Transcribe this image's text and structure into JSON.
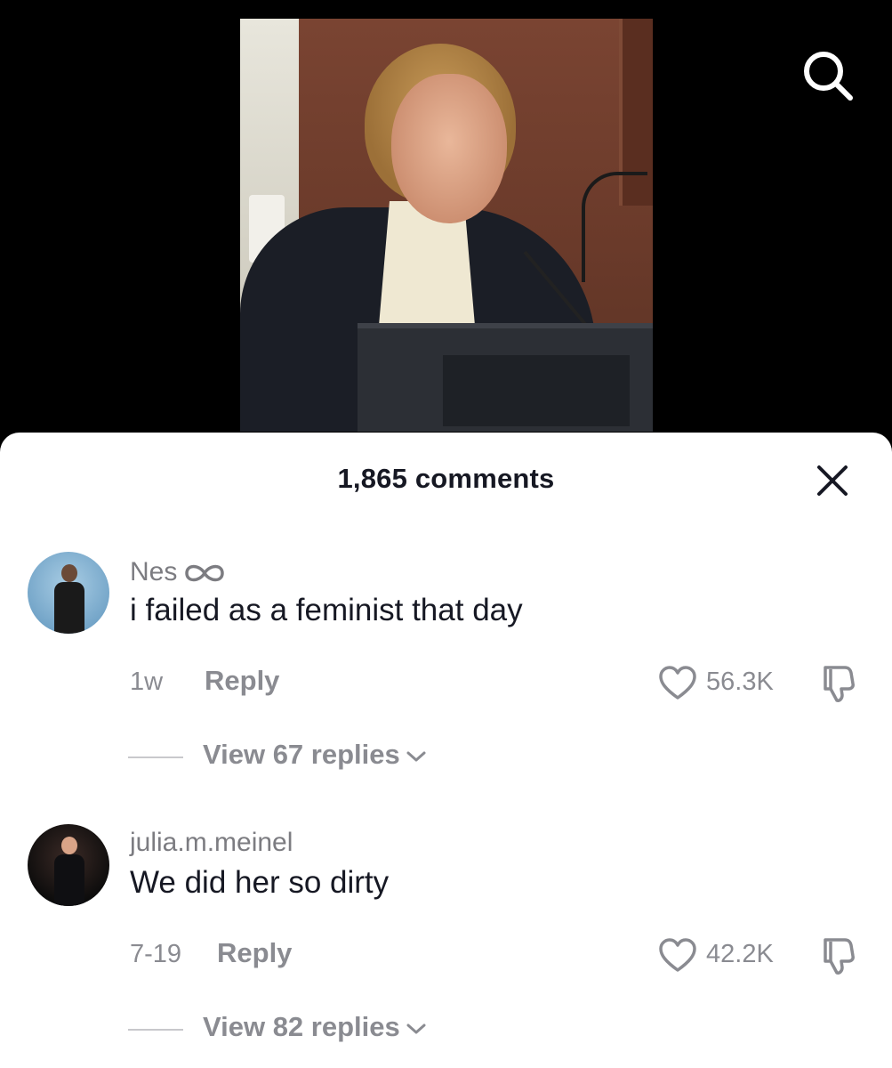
{
  "video": {
    "description_icon": "video-still"
  },
  "header": {
    "search_icon": "search-icon"
  },
  "sheet": {
    "title": "1,865 comments",
    "close_icon": "close-icon"
  },
  "comments": [
    {
      "username": "Nes",
      "badge_icon": "infinity-icon",
      "text": "i failed as a feminist that day",
      "time": "1w",
      "reply_label": "Reply",
      "likes": "56.3K",
      "view_replies": "View 67 replies"
    },
    {
      "username": "julia.m.meinel",
      "text": "We did her so dirty",
      "time": "7-19",
      "reply_label": "Reply",
      "likes": "42.2K",
      "view_replies": "View 82 replies"
    }
  ],
  "colors": {
    "background": "#000000",
    "sheet": "#ffffff",
    "text_primary": "#161823",
    "text_secondary": "#8a8b91"
  }
}
